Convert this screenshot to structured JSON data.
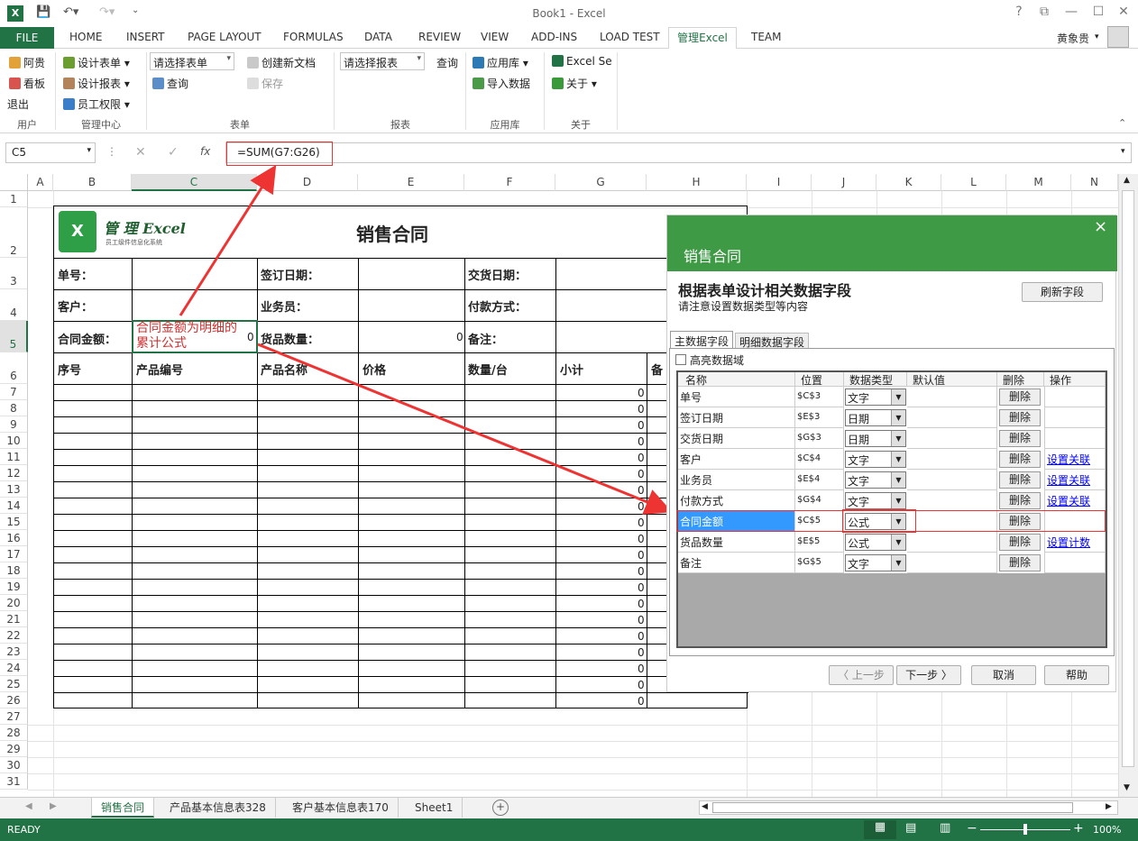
{
  "title_bar": {
    "title": "Book1 - Excel",
    "help": "?"
  },
  "tabs": [
    "FILE",
    "HOME",
    "INSERT",
    "PAGE LAYOUT",
    "FORMULAS",
    "DATA",
    "REVIEW",
    "VIEW",
    "ADD-INS",
    "LOAD TEST",
    "管理Excel",
    "TEAM"
  ],
  "user": "黄象贵",
  "ribbon": {
    "user_group": {
      "label": "用户",
      "items": [
        "阿贵",
        "看板",
        "退出"
      ]
    },
    "mgmt_group": {
      "label": "管理中心",
      "items": [
        "设计表单",
        "设计报表",
        "员工权限"
      ]
    },
    "form_group": {
      "label": "表单",
      "select_placeholder": "请选择表单",
      "query": "查询",
      "new_doc": "创建新文档",
      "save": "保存"
    },
    "report_group": {
      "label": "报表",
      "select_placeholder": "请选择报表",
      "query": "查询"
    },
    "app_group": {
      "label": "应用库",
      "items": [
        "应用库",
        "导入数据"
      ]
    },
    "about_group": {
      "label": "关于",
      "items": [
        "Excel Se",
        "关于"
      ]
    }
  },
  "formula_bar": {
    "name_box": "C5",
    "formula": "=SUM(G7:G26)",
    "fx": "fx"
  },
  "columns": [
    "A",
    "B",
    "C",
    "D",
    "E",
    "F",
    "G",
    "H",
    "I",
    "J",
    "K",
    "L",
    "M",
    "N"
  ],
  "rows": [
    "1",
    "2",
    "3",
    "4",
    "5",
    "6",
    "7",
    "8",
    "9",
    "10",
    "11",
    "12",
    "13",
    "14",
    "15",
    "16",
    "17",
    "18",
    "19",
    "20",
    "21",
    "22",
    "23",
    "24",
    "25",
    "26",
    "27",
    "28",
    "29",
    "30",
    "31"
  ],
  "sheet": {
    "logo_text": "管 理 Excel",
    "logo_sub": "员工级件信息化系统",
    "contract_title": "销售合同",
    "labels": {
      "order_no": "单号：",
      "sign_date": "签订日期：",
      "delivery_date": "交货日期：",
      "customer": "客户：",
      "salesman": "业务员：",
      "payment": "付款方式：",
      "amount": "合同金额：",
      "qty": "货品数量：",
      "note": "备注：",
      "zero": "0"
    },
    "headers": [
      "序号",
      "产品编号",
      "产品名称",
      "价格",
      "数量/台",
      "小计",
      "备"
    ],
    "subtotal_zero": "0"
  },
  "annotation": "合同金额为明细的累计公式",
  "sheet_tabs": [
    "销售合同",
    "产品基本信息表328",
    "客户基本信息表170",
    "Sheet1"
  ],
  "status": {
    "ready": "READY",
    "zoom": "100%"
  },
  "dialog": {
    "title": "销售合同",
    "close": "×",
    "heading": "根据表单设计相关数据字段",
    "sub": "请注意设置数据类型等内容",
    "refresh": "刷新字段",
    "tabs": [
      "主数据字段",
      "明细数据字段"
    ],
    "highlight": "高亮数据域",
    "columns": [
      "名称",
      "位置",
      "数据类型",
      "默认值",
      "删除",
      "操作"
    ],
    "rows": [
      {
        "name": "单号",
        "pos": "$C$3",
        "type": "文字",
        "del": "删除",
        "op": ""
      },
      {
        "name": "签订日期",
        "pos": "$E$3",
        "type": "日期",
        "del": "删除",
        "op": ""
      },
      {
        "name": "交货日期",
        "pos": "$G$3",
        "type": "日期",
        "del": "删除",
        "op": ""
      },
      {
        "name": "客户",
        "pos": "$C$4",
        "type": "文字",
        "del": "删除",
        "op": "设置关联"
      },
      {
        "name": "业务员",
        "pos": "$E$4",
        "type": "文字",
        "del": "删除",
        "op": "设置关联"
      },
      {
        "name": "付款方式",
        "pos": "$G$4",
        "type": "文字",
        "del": "删除",
        "op": "设置关联"
      },
      {
        "name": "合同金额",
        "pos": "$C$5",
        "type": "公式",
        "del": "删除",
        "op": ""
      },
      {
        "name": "货品数量",
        "pos": "$E$5",
        "type": "公式",
        "del": "删除",
        "op": "设置计数"
      },
      {
        "name": "备注",
        "pos": "$G$5",
        "type": "文字",
        "del": "删除",
        "op": ""
      }
    ],
    "buttons": {
      "prev": "〈 上一步",
      "next": "下一步 〉",
      "cancel": "取消",
      "help": "帮助"
    }
  }
}
